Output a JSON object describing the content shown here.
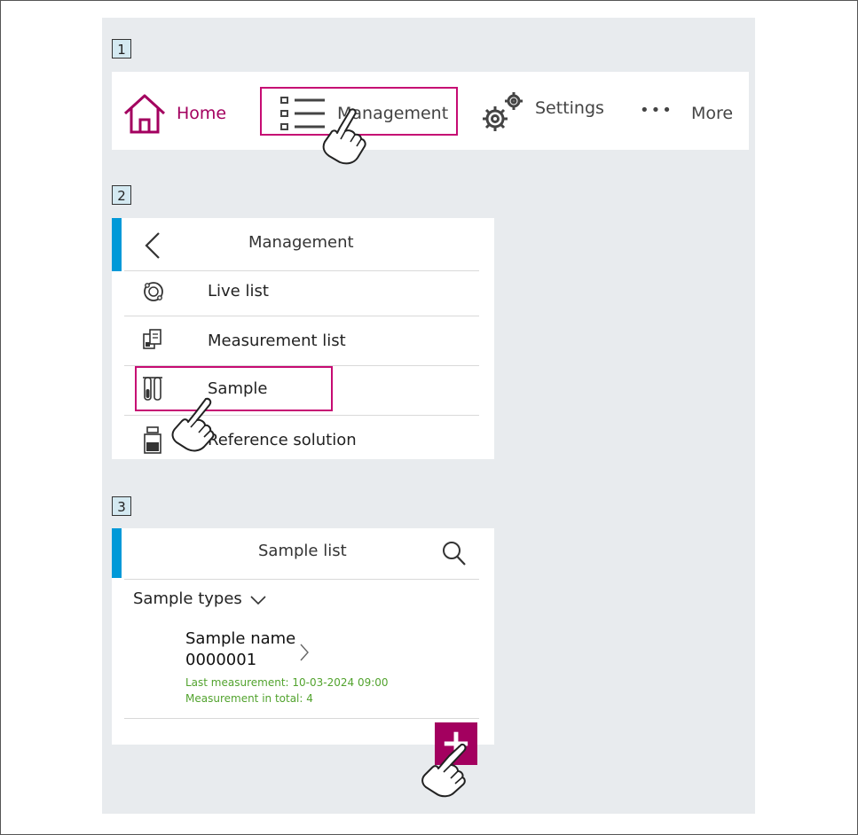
{
  "steps": [
    "1",
    "2",
    "3"
  ],
  "nav": {
    "home": "Home",
    "management": "Management",
    "settings": "Settings",
    "more_dots": "•••",
    "more": "More"
  },
  "management_menu": {
    "title": "Management",
    "items": [
      {
        "label": "Live list",
        "icon": "live-list-icon"
      },
      {
        "label": "Measurement list",
        "icon": "measurement-list-icon"
      },
      {
        "label": "Sample",
        "icon": "test-tube-icon"
      },
      {
        "label": "Reference solution",
        "icon": "bottle-icon"
      }
    ]
  },
  "sample_list": {
    "title": "Sample list",
    "filter_label": "Sample types",
    "entry": {
      "name": "Sample name",
      "id": "0000001",
      "last_measurement": "Last measurement: 10-03-2024 09:00",
      "total": "Measurement in total: 4"
    },
    "add_symbol": "+"
  },
  "colors": {
    "accent_magenta": "#a3005f",
    "accent_blue": "#0099d8",
    "status_green": "#52a32e",
    "panel_bg": "#e8ebee"
  }
}
